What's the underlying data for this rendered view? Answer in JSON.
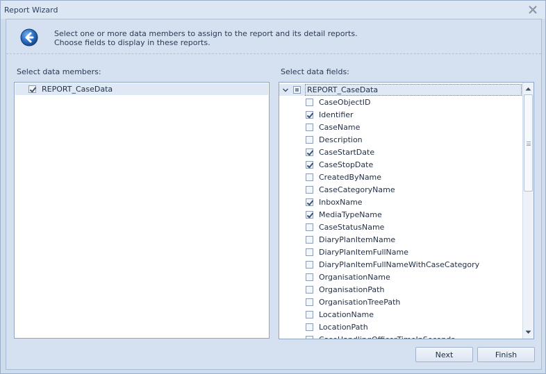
{
  "window": {
    "title": "Report Wizard"
  },
  "header": {
    "line1": "Select one or more data members to assign to the report and its detail reports.",
    "line2": "Choose fields to display in these reports."
  },
  "members": {
    "label": "Select data members:",
    "items": [
      {
        "name": "REPORT_CaseData",
        "checked": true
      }
    ]
  },
  "fields": {
    "label": "Select data fields:",
    "root": {
      "name": "REPORT_CaseData",
      "state": "partial",
      "expanded": true
    },
    "items": [
      {
        "name": "CaseObjectID",
        "checked": false
      },
      {
        "name": "Identifier",
        "checked": true
      },
      {
        "name": "CaseName",
        "checked": false
      },
      {
        "name": "Description",
        "checked": false
      },
      {
        "name": "CaseStartDate",
        "checked": true
      },
      {
        "name": "CaseStopDate",
        "checked": true
      },
      {
        "name": "CreatedByName",
        "checked": false
      },
      {
        "name": "CaseCategoryName",
        "checked": false
      },
      {
        "name": "InboxName",
        "checked": true
      },
      {
        "name": "MediaTypeName",
        "checked": true
      },
      {
        "name": "CaseStatusName",
        "checked": false
      },
      {
        "name": "DiaryPlanItemName",
        "checked": false
      },
      {
        "name": "DiaryPlanItemFullName",
        "checked": false
      },
      {
        "name": "DiaryPlanItemFullNameWithCaseCategory",
        "checked": false
      },
      {
        "name": "OrganisationName",
        "checked": false
      },
      {
        "name": "OrganisationPath",
        "checked": false
      },
      {
        "name": "OrganisationTreePath",
        "checked": false
      },
      {
        "name": "LocationName",
        "checked": false
      },
      {
        "name": "LocationPath",
        "checked": false
      },
      {
        "name": "CaseHandlingOfficerTimeInSeconds",
        "checked": false
      }
    ]
  },
  "buttons": {
    "next": "Next",
    "finish": "Finish"
  },
  "icons": {
    "close": "close-icon",
    "back": "back-arrow-icon",
    "expander": "chevron-down-icon",
    "scroll_up": "scroll-up-icon",
    "scroll_down": "scroll-down-icon"
  },
  "colors": {
    "accent": "#2a6fc4",
    "selection": "#dfe9f5"
  }
}
